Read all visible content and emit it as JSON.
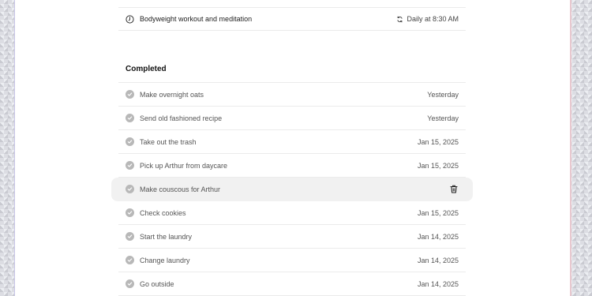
{
  "upcoming": {
    "label": "Bodyweight workout and meditation",
    "schedule": "Daily at 8:30 AM",
    "icon": "clock-icon",
    "repeat_icon": "repeat-icon"
  },
  "completed": {
    "heading": "Completed",
    "items": [
      {
        "label": "Make overnight oats",
        "date": "Yesterday"
      },
      {
        "label": "Send old fashioned recipe",
        "date": "Yesterday"
      },
      {
        "label": "Take out the trash",
        "date": "Jan 15, 2025"
      },
      {
        "label": "Pick up Arthur from daycare",
        "date": "Jan 15, 2025"
      },
      {
        "label": "Make couscous for Arthur",
        "date": "",
        "hovered": true
      },
      {
        "label": "Check cookies",
        "date": "Jan 15, 2025"
      },
      {
        "label": "Start the laundry",
        "date": "Jan 14, 2025"
      },
      {
        "label": "Change laundry",
        "date": "Jan 14, 2025"
      },
      {
        "label": "Go outside",
        "date": "Jan 14, 2025"
      }
    ]
  },
  "colors": {
    "check_fill": "#b8b8b8",
    "hover_bg": "#f1f1f1"
  }
}
